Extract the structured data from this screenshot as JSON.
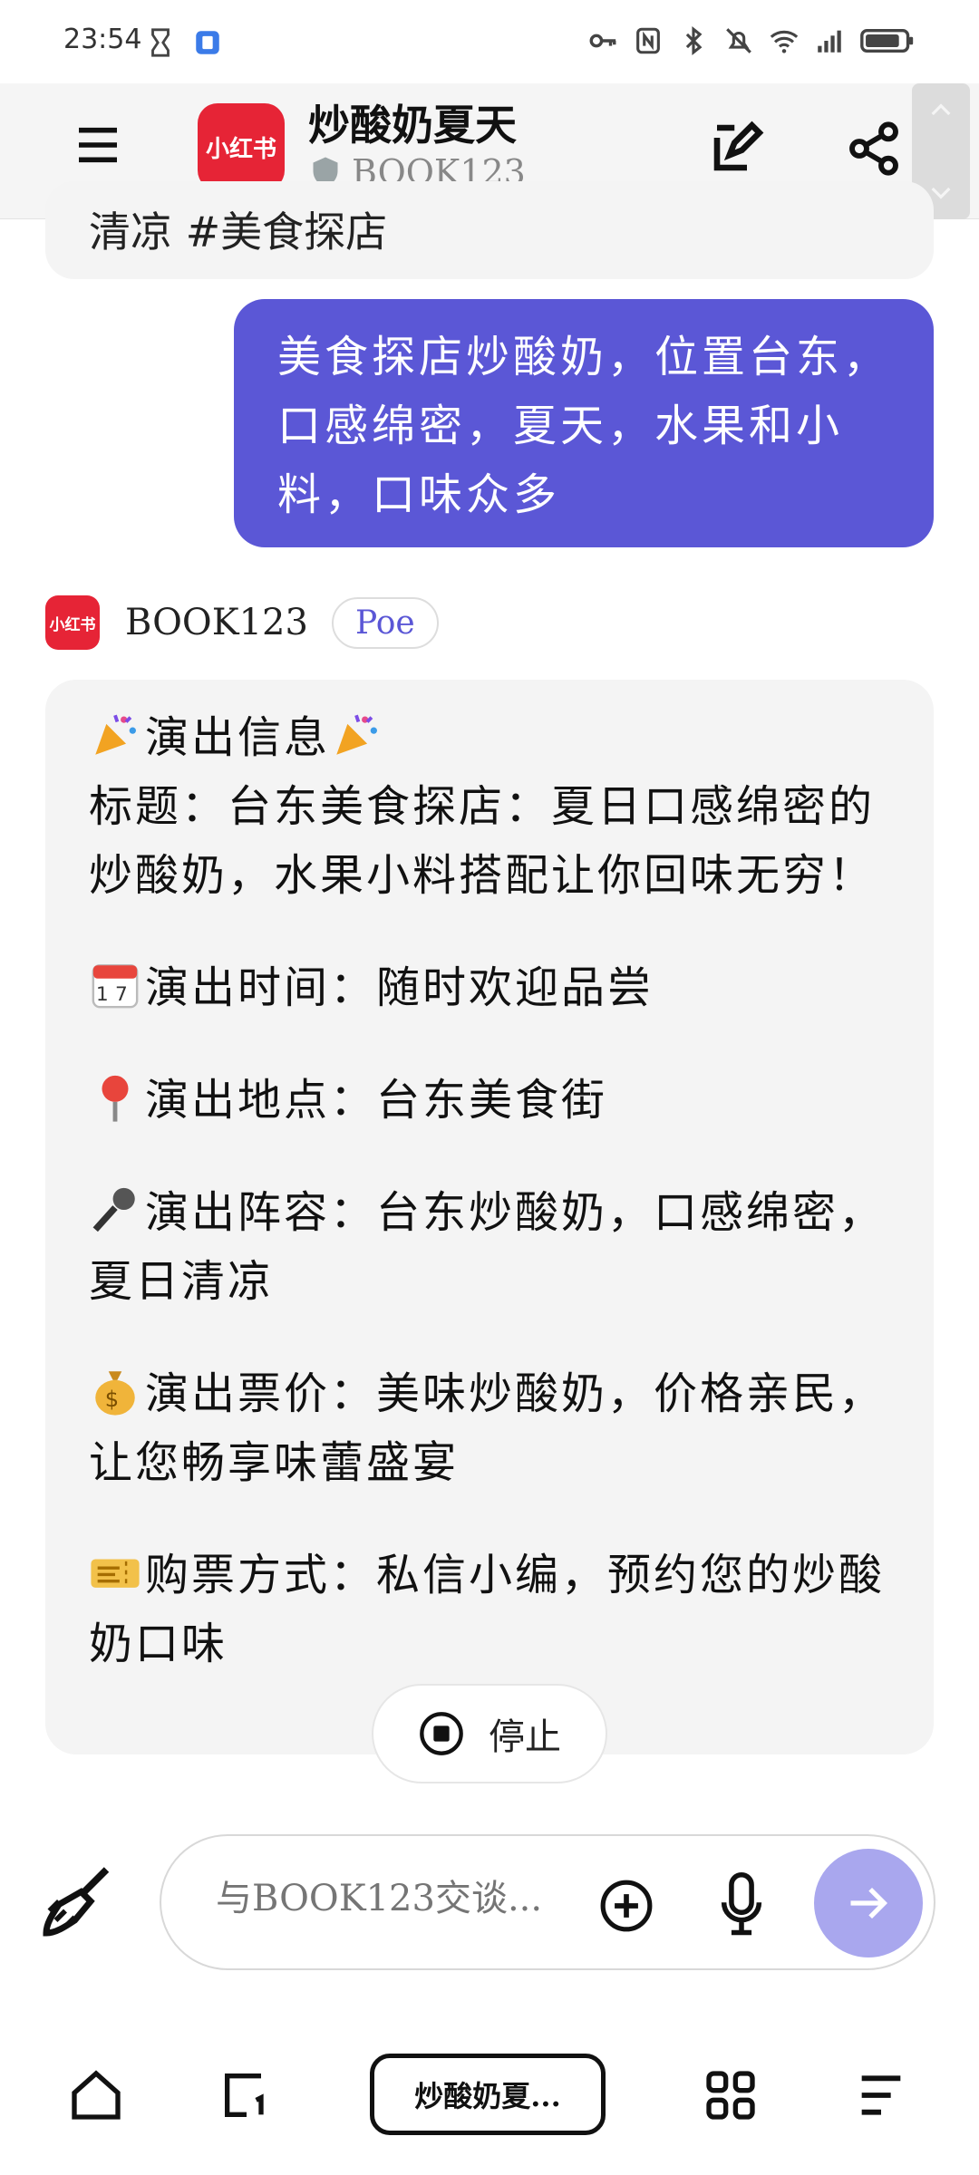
{
  "status_bar": {
    "time": "23:54"
  },
  "header": {
    "logo_text": "小红书",
    "title": "炒酸奶夏天",
    "subtitle": "BOOK123"
  },
  "chat": {
    "previous_fragment": "清凉 #美食探店",
    "user_message": "美食探店炒酸奶，位置台东，口感绵密，夏天，水果和小料，口味众多",
    "bot_name": "BOOK123",
    "bot_avatar_text": "小红书",
    "bot_badge": "Poe",
    "bot_lines": {
      "heading": "演出信息",
      "title_line": "标题：台东美食探店：夏日口感绵密的炒酸奶，水果小料搭配让你回味无穷！",
      "time_line": "演出时间：随时欢迎品尝",
      "place_line": "演出地点：台东美食街",
      "cast_line": "演出阵容：台东炒酸奶，口感绵密，夏日清凉",
      "price_line": "演出票价：美味炒酸奶，价格亲民，让您畅享味蕾盛宴",
      "ticket_line": "购票方式：私信小编，预约您的炒酸奶口味"
    },
    "stop_label": "停止"
  },
  "composer": {
    "placeholder": "与BOOK123交谈..."
  },
  "bottom_nav": {
    "tab_label": "炒酸奶夏..."
  },
  "colors": {
    "accent": "#5b57d6",
    "brand_red": "#e62436",
    "send_disabled": "#a9a7ee"
  }
}
